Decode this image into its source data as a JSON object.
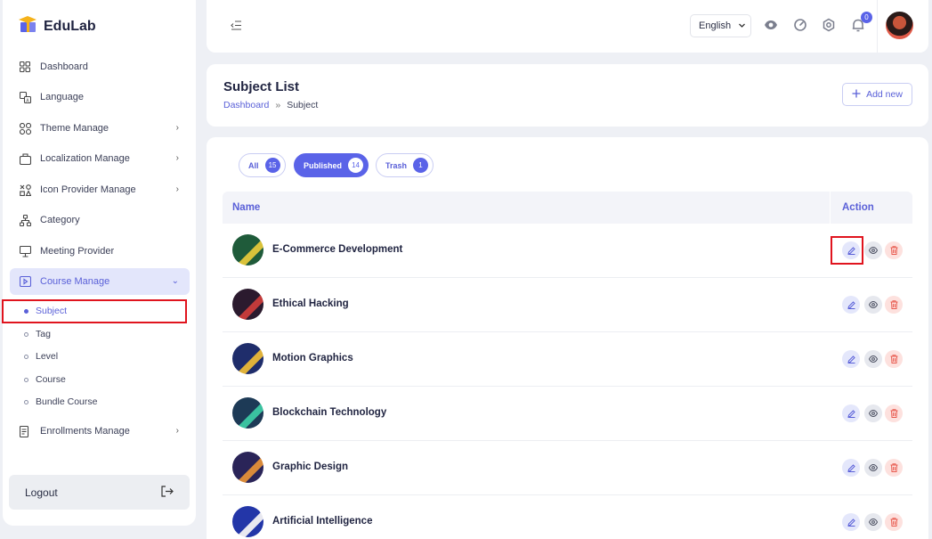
{
  "brand": {
    "name": "EduLab"
  },
  "sidebar": {
    "items": [
      {
        "label": "Dashboard",
        "icon": "grid-icon"
      },
      {
        "label": "Language",
        "icon": "translate-icon"
      },
      {
        "label": "Theme Manage",
        "icon": "theme-icon",
        "has_children": true
      },
      {
        "label": "Localization Manage",
        "icon": "localization-icon",
        "has_children": true
      },
      {
        "label": "Icon Provider Manage",
        "icon": "shapes-icon",
        "has_children": true
      },
      {
        "label": "Category",
        "icon": "sitemap-icon"
      },
      {
        "label": "Meeting Provider",
        "icon": "presentation-icon"
      },
      {
        "label": "Course Manage",
        "icon": "video-icon",
        "has_children": true,
        "expanded": true
      },
      {
        "label": "Enrollments Manage",
        "icon": "document-icon",
        "has_children": true
      }
    ],
    "course_sub_items": [
      "Subject",
      "Tag",
      "Level",
      "Course",
      "Bundle Course"
    ],
    "active_sub_item": "Subject",
    "logout_label": "Logout"
  },
  "topbar": {
    "language": "English",
    "notification_count": "0"
  },
  "page": {
    "title": "Subject List",
    "breadcrumb": {
      "home": "Dashboard",
      "separator": "»",
      "current": "Subject"
    },
    "add_button_label": "Add new"
  },
  "filters": [
    {
      "label": "All",
      "count": "15",
      "active": false
    },
    {
      "label": "Published",
      "count": "14",
      "active": true
    },
    {
      "label": "Trash",
      "count": "1",
      "active": false
    }
  ],
  "table": {
    "columns": [
      "Name",
      "Action"
    ],
    "rows": [
      {
        "name": "E-Commerce Development"
      },
      {
        "name": "Ethical Hacking"
      },
      {
        "name": "Motion Graphics"
      },
      {
        "name": "Blockchain Technology"
      },
      {
        "name": "Graphic Design"
      },
      {
        "name": "Artificial Intelligence"
      }
    ]
  },
  "colors": {
    "accent": "#5A63E8",
    "danger": "#E85A4F",
    "highlight": "#E0141E"
  }
}
